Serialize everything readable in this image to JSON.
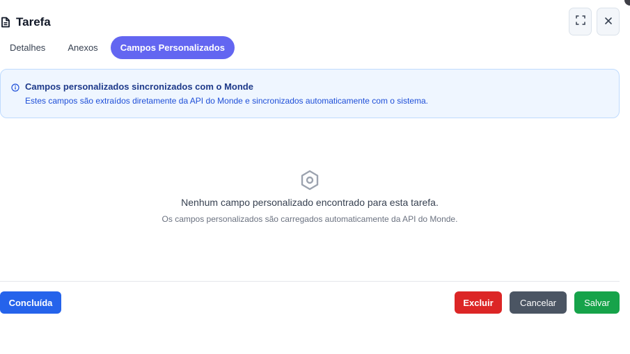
{
  "dialog": {
    "title": "Tarefa",
    "title_icon": "document-icon",
    "expand_icon": "expand-icon",
    "close_icon": "close-icon"
  },
  "tabs": [
    {
      "label": "Detalhes",
      "active": false
    },
    {
      "label": "Anexos",
      "active": false
    },
    {
      "label": "Campos Personalizados",
      "active": true
    }
  ],
  "info_banner": {
    "icon": "info-icon",
    "title": "Campos personalizados sincronizados com o Monde",
    "text": "Estes campos são extraídos diretamente da API do Monde e sincronizados automaticamente com o sistema."
  },
  "empty_state": {
    "icon": "nut-icon",
    "title": "Nenhum campo personalizado encontrado para esta tarefa.",
    "subtitle": "Os campos personalizados são carregados automaticamente da API do Monde."
  },
  "footer": {
    "concluida_label": "Concluída",
    "excluir_label": "Excluir",
    "cancelar_label": "Cancelar",
    "salvar_label": "Salvar"
  },
  "colors": {
    "active_tab": "#6366f1",
    "concluida": "#2563eb",
    "excluir": "#dc2626",
    "cancelar": "#4b5563",
    "salvar": "#16a34a",
    "info_background": "#eff6ff"
  }
}
